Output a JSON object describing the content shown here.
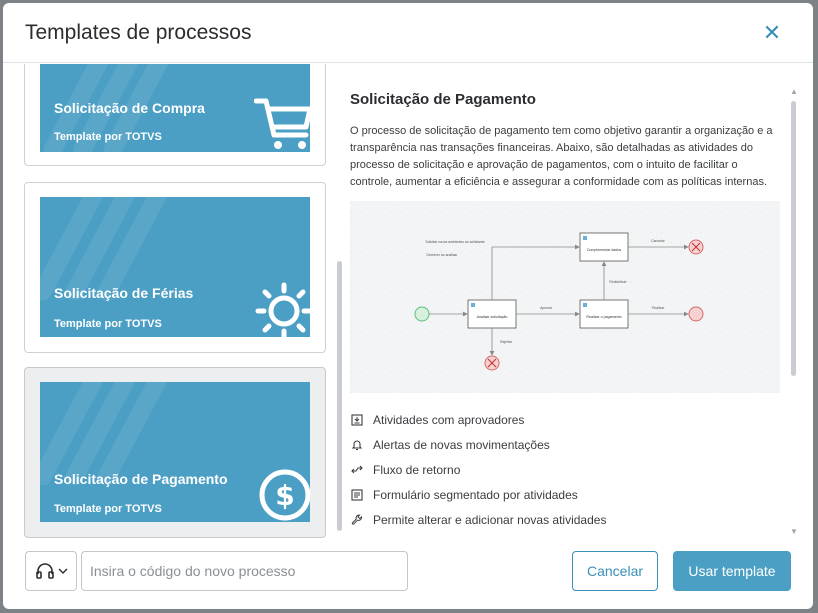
{
  "modal": {
    "title": "Templates de processos"
  },
  "templates": [
    {
      "name": "Solicitação de Compra",
      "author": "Template por TOTVS",
      "icon": "cart-icon"
    },
    {
      "name": "Solicitação de Férias",
      "author": "Template por TOTVS",
      "icon": "sun-icon"
    },
    {
      "name": "Solicitação de Pagamento",
      "author": "Template por TOTVS",
      "icon": "dollar-icon",
      "selected": true
    }
  ],
  "detail": {
    "title": "Solicitação de Pagamento",
    "description": "O processo de solicitação de pagamento tem como objetivo garantir a organização e a transparência nas transações financeiras. Abaixo, são detalhadas as atividades do processo de solicitação e aprovação de pagamentos, com o intuito de facilitar o controle, aumentar a eficiência e assegurar a conformidade com as políticas internas.",
    "diagram": {
      "nodes": [
        "Analisar solicitação",
        "Complementar dados",
        "Realizar o pagamento"
      ],
      "edges": [
        "Solicitar novos ambientes ao solicitante",
        "Devolver ao analisar",
        "Aprovar",
        "Rejeitar",
        "Cancelar",
        "Redistribuir",
        "Finalizar"
      ]
    },
    "features": [
      {
        "icon": "approval-icon",
        "label": "Atividades com aprovadores"
      },
      {
        "icon": "bell-icon",
        "label": "Alertas de novas movimentações"
      },
      {
        "icon": "return-flow-icon",
        "label": "Fluxo de retorno"
      },
      {
        "icon": "form-icon",
        "label": "Formulário segmentado por atividades"
      },
      {
        "icon": "wrench-icon",
        "label": "Permite alterar e adicionar novas atividades"
      }
    ]
  },
  "footer": {
    "code_placeholder": "Insira o código do novo processo",
    "cancel_label": "Cancelar",
    "use_label": "Usar template"
  },
  "colors": {
    "accent": "#4b9fc4",
    "link": "#3a8fb7"
  }
}
